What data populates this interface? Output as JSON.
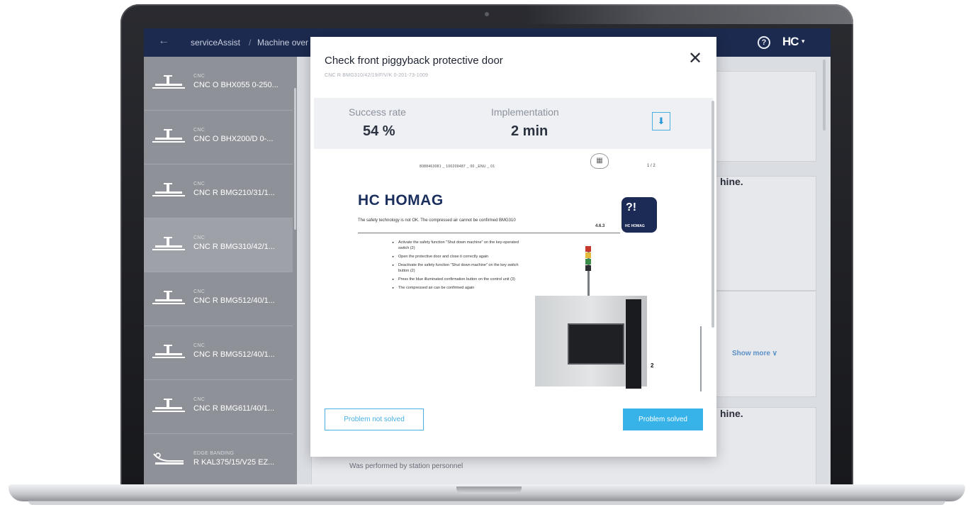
{
  "topbar": {
    "app_name": "serviceAssist",
    "separator": "/",
    "page_name": "Machine over",
    "help_glyph": "?",
    "logo": "HC",
    "logo_caret": "▾"
  },
  "sidebar": {
    "items": [
      {
        "type": "CNC",
        "name": "CNC O BHX055 0-250..."
      },
      {
        "type": "CNC",
        "name": "CNC O BHX200/D 0-..."
      },
      {
        "type": "CNC",
        "name": "CNC R BMG210/31/1..."
      },
      {
        "type": "CNC",
        "name": "CNC R BMG310/42/1...",
        "active": true
      },
      {
        "type": "CNC",
        "name": "CNC R BMG512/40/1..."
      },
      {
        "type": "CNC",
        "name": "CNC R BMG512/40/1..."
      },
      {
        "type": "CNC",
        "name": "CNC R BMG611/40/1..."
      },
      {
        "type": "EDGE BANDING",
        "name": "R KAL375/15/V25 EZ..."
      }
    ]
  },
  "background": {
    "card1_title_tail": "hine.",
    "card2_title_tail": "hine.",
    "show_more": "Show more ∨",
    "bottom_text": "Was performed by station personnel"
  },
  "modal": {
    "title": "Check front piggyback protective door",
    "subtitle": "CNC R BMG310/42/19/F/V/K 0-201-73-1009",
    "close_glyph": "✕",
    "success_rate_label": "Success rate",
    "success_rate_value": "54 %",
    "implementation_label": "Implementation",
    "implementation_value": "2 min",
    "download_glyph": "⬇",
    "document": {
      "ref": "8088463081 _ 100209487 _ 00 _ENU _ 01",
      "page": "1 / 2",
      "logo": "HC HOMAG",
      "badge_glyph": "?!",
      "badge_text": "HC HOMAG",
      "intro": "The safety technology is not OK. The compressed air cannot be confirmed BMG310",
      "section": "4.6.3",
      "steps": [
        "Activate the safety function \"Shut down machine\" on the key-operated switch (2)",
        "Open the protective door and close it correctly again",
        "Deactivate the safety function \"Shut down machine\" on the key switch button (2)",
        "Press the blue illuminated confirmation button on the control unit (3)",
        "The compressed air can be confirmed again"
      ],
      "photo_label": "2"
    },
    "btn_not_solved": "Problem not solved",
    "btn_solved": "Problem solved"
  },
  "colors": {
    "topbar": "#1c2a4f",
    "accent": "#37b3ea",
    "sidebar": "#8e9197"
  }
}
